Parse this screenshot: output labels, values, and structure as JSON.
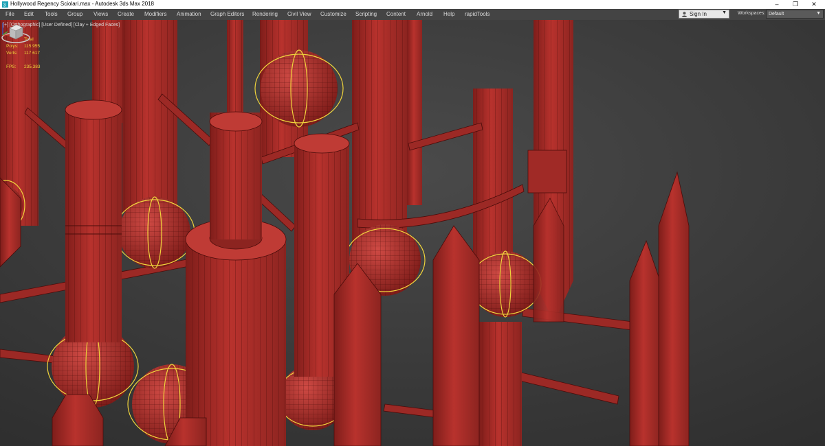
{
  "window": {
    "title": "Hollywood Regency Sciolari.max - Autodesk 3ds Max 2018",
    "minimize": "–",
    "restore": "❐",
    "close": "✕"
  },
  "menu": {
    "items": [
      "File",
      "Edit",
      "Tools",
      "Group",
      "Views",
      "Create",
      "Modifiers",
      "Animation",
      "Graph Editors",
      "Rendering",
      "Civil View",
      "Customize",
      "Scripting",
      "Content",
      "Arnold",
      "Help",
      "rapidTools"
    ],
    "sign_in": "Sign In",
    "workspaces_label": "Workspaces:",
    "workspaces_value": "Default"
  },
  "viewport": {
    "label": "[+] [Orthographic] [User Defined] [Clay + Edged Faces]",
    "stats": {
      "header": "Total",
      "polys_label": "Polys:",
      "polys_value": "115 955",
      "verts_label": "Verts:",
      "verts_value": "117 617",
      "fps_label": "FPS:",
      "fps_value": "235,383"
    }
  },
  "colors": {
    "viewport_bg": "#3c3c3c",
    "clay": "#b3302c",
    "clay_dark": "#7a1a17",
    "selection": "#f0d43c"
  }
}
